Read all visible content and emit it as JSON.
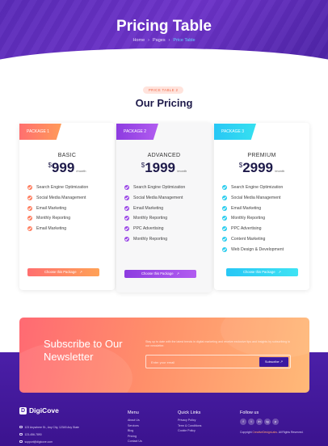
{
  "hero": {
    "title": "Pricing Table",
    "breadcrumb": [
      "Home",
      "Pages",
      "Price Table"
    ]
  },
  "section": {
    "badge": "PRICE TABLE 2",
    "title": "Our Pricing"
  },
  "plans": [
    {
      "tag": "PACKAGE 1",
      "name": "BASIC",
      "currency": "$",
      "price": "999",
      "period": "/month",
      "accent": "#ff7d5e",
      "features": [
        "Search Engine Optimization",
        "Social Media Management",
        "Email Marketing",
        "Monthly Reporting",
        "Email Marketing"
      ],
      "button": "Choose this Package"
    },
    {
      "tag": "PACKAGE 2",
      "name": "ADVANCED",
      "currency": "$",
      "price": "1999",
      "period": "/month",
      "accent": "#9b49e6",
      "features": [
        "Search Engine Optimization",
        "Social Media Management",
        "Email Marketing",
        "Monthly Reporting",
        "PPC Advertising",
        "Monthly Reporting"
      ],
      "button": "Choose this Package"
    },
    {
      "tag": "PACKAGE 3",
      "name": "PREMIUM",
      "currency": "$",
      "price": "2999",
      "period": "/month",
      "accent": "#2bcdee",
      "features": [
        "Search Engine Optimization",
        "Social Media Management",
        "Email Marketing",
        "Monthly Reporting",
        "PPC Advertising",
        "Content Marketing",
        "Web Design & Development"
      ],
      "button": "Choose this Package"
    }
  ],
  "newsletter": {
    "title": "Subscribe to Our Newsletter",
    "text": "Stay up to date with the latest trends in digital marketing and receive exclusive tips and insights by subscribing to our newsletter.",
    "placeholder": "Enter your email",
    "button": "Subscribe"
  },
  "footer": {
    "brand": "DigiCove",
    "address": "123 Anywhere St., Any City, 12345 Any State",
    "phone": "123-456-7890",
    "email": "support@digicove.com",
    "menu_title": "Menu",
    "menu": [
      "About Us",
      "Services",
      "Blog",
      "Pricing",
      "Contact Us"
    ],
    "quick_title": "Quick Links",
    "quick": [
      "Privacy Policy",
      "Term & Conditions",
      "Cookie Policy"
    ],
    "follow_title": "Follow us",
    "socials": [
      "f",
      "t",
      "in",
      "ig",
      "p"
    ],
    "copyright_prefix": "Copyright",
    "copyright_brand": "CreativeDesignLabs",
    "copyright_suffix": ". All Rights Reserved."
  }
}
